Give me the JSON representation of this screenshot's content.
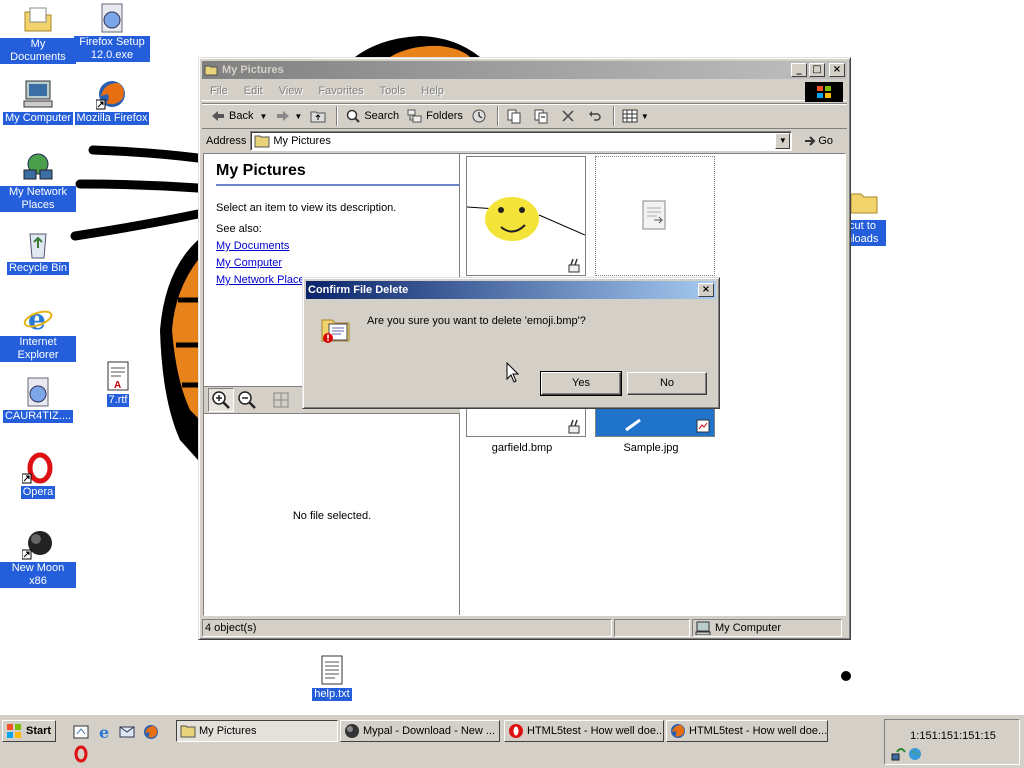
{
  "desktop": {
    "icons": [
      {
        "label": "My Documents"
      },
      {
        "label": "Firefox Setup 12.0.exe"
      },
      {
        "label": "My Computer"
      },
      {
        "label": "Mozilla Firefox"
      },
      {
        "label": "My Network Places"
      },
      {
        "label": "Recycle Bin"
      },
      {
        "label": "Internet Explorer"
      },
      {
        "label": "7.rtf"
      },
      {
        "label": "CAUR4TIZ...."
      },
      {
        "label": "Opera"
      },
      {
        "label": "New Moon x86"
      },
      {
        "label": "help.txt"
      },
      {
        "label": "tcut to nloads"
      }
    ]
  },
  "window": {
    "title": "My Pictures",
    "menu": [
      "File",
      "Edit",
      "View",
      "Favorites",
      "Tools",
      "Help"
    ],
    "toolbar": {
      "back": "Back",
      "search": "Search",
      "folders": "Folders"
    },
    "address": {
      "label": "Address",
      "value": "My Pictures",
      "go": "Go"
    },
    "leftpane": {
      "title": "My Pictures",
      "description": "Select an item to view its description.",
      "see_also": "See also:",
      "links": [
        "My Documents",
        "My Computer",
        "My Network Places"
      ],
      "preview_message": "No file selected."
    },
    "files": [
      "garfield.bmp",
      "Sample.jpg"
    ],
    "status": {
      "objects": "4 object(s)",
      "zone": "My Computer"
    }
  },
  "dialog": {
    "title": "Confirm File Delete",
    "message": "Are you sure you want to delete 'emoji.bmp'?",
    "yes": "Yes",
    "no": "No"
  },
  "taskbar": {
    "start": "Start",
    "buttons": [
      "My Pictures",
      "Mypal - Download - New ...",
      "HTML5test - How well doe...",
      "HTML5test - How well doe..."
    ],
    "clock": "1:151:151:151:15"
  },
  "colors": {
    "selection": "#245edb",
    "face": "#d4d0c8",
    "active_title": "#0a246a",
    "inactive_title": "#808080",
    "link": "#0000cc"
  }
}
